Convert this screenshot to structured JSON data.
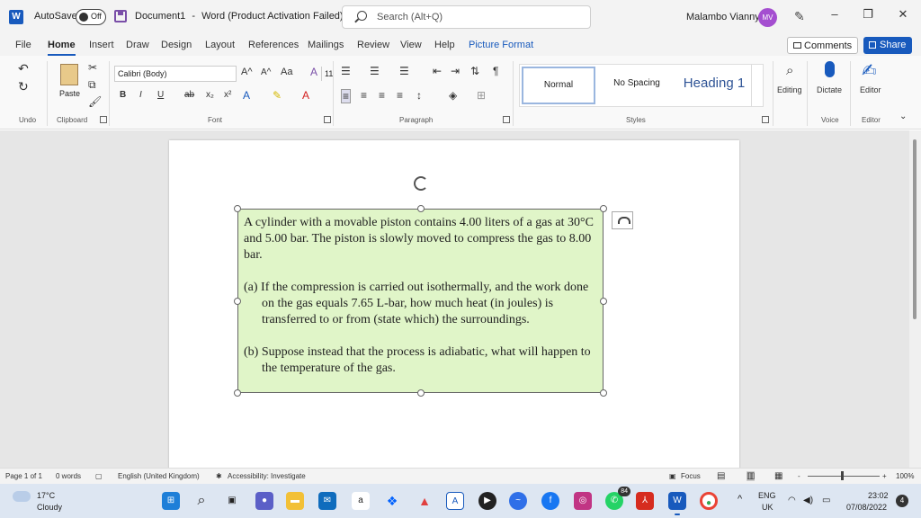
{
  "titlebar": {
    "autosave_label": "AutoSave",
    "autosave_state": "Off",
    "doc_name": "Document1",
    "separator": "-",
    "app_title": "Word (Product Activation Failed)",
    "search_placeholder": "Search (Alt+Q)",
    "user_name": "Malambo Vianny",
    "user_initials": "MV",
    "icons": [
      "word-logo",
      "save-icon",
      "search-icon",
      "pen-icon",
      "minimize-icon",
      "restore-icon",
      "close-icon"
    ]
  },
  "ribbon_tabs": {
    "items": [
      {
        "label": "File"
      },
      {
        "label": "Home"
      },
      {
        "label": "Insert"
      },
      {
        "label": "Draw"
      },
      {
        "label": "Design"
      },
      {
        "label": "Layout"
      },
      {
        "label": "References"
      },
      {
        "label": "Mailings"
      },
      {
        "label": "Review"
      },
      {
        "label": "View"
      },
      {
        "label": "Help"
      },
      {
        "label": "Picture Format"
      }
    ],
    "active": "Home",
    "comments_label": "Comments",
    "share_label": "Share"
  },
  "ribbon": {
    "undo_group": "Undo",
    "clipboard_group": "Clipboard",
    "paste_label": "Paste",
    "font_group": "Font",
    "font_name": "Calibri (Body)",
    "font_size": "11",
    "bold": "B",
    "italic": "I",
    "underline": "U",
    "strike": "ab",
    "grow_font": "A^",
    "shrink_font": "A^",
    "change_case": "Aa",
    "paragraph_group": "Paragraph",
    "styles_group": "Styles",
    "styles": [
      {
        "label": "Normal"
      },
      {
        "label": "No Spacing"
      },
      {
        "label": "Heading 1"
      }
    ],
    "editing_label": "Editing",
    "dictate_label": "Dictate",
    "voice_group": "Voice",
    "editor_label": "Editor",
    "editor_group": "Editor",
    "accent_color": "#185abd"
  },
  "document": {
    "textbox_fill": "#e0f5c8",
    "paragraph_1": "A cylinder with a movable piston contains 4.00 liters of a gas at 30°C and 5.00 bar. The piston is slowly moved to compress the gas to 8.00 bar.",
    "paragraph_2": "(a) If the compression is carried out isothermally, and the work done on the gas equals 7.65 L-bar, how much heat (in joules) is transferred to or from (state which) the surroundings.",
    "paragraph_3": "(b) Suppose instead that the process is adiabatic, what will happen to the temperature of the gas."
  },
  "statusbar": {
    "page": "Page 1 of 1",
    "words": "0 words",
    "language": "English (United Kingdom)",
    "accessibility": "Accessibility: Investigate",
    "focus": "Focus",
    "zoom_minus": "-",
    "zoom_plus": "+",
    "zoom": "100%"
  },
  "taskbar": {
    "temperature": "17°C",
    "weather": "Cloudy",
    "lang_line1": "ENG",
    "lang_line2": "UK",
    "time": "23:02",
    "date": "07/08/2022",
    "notifications": "4",
    "whatsapp_badge": "84"
  }
}
